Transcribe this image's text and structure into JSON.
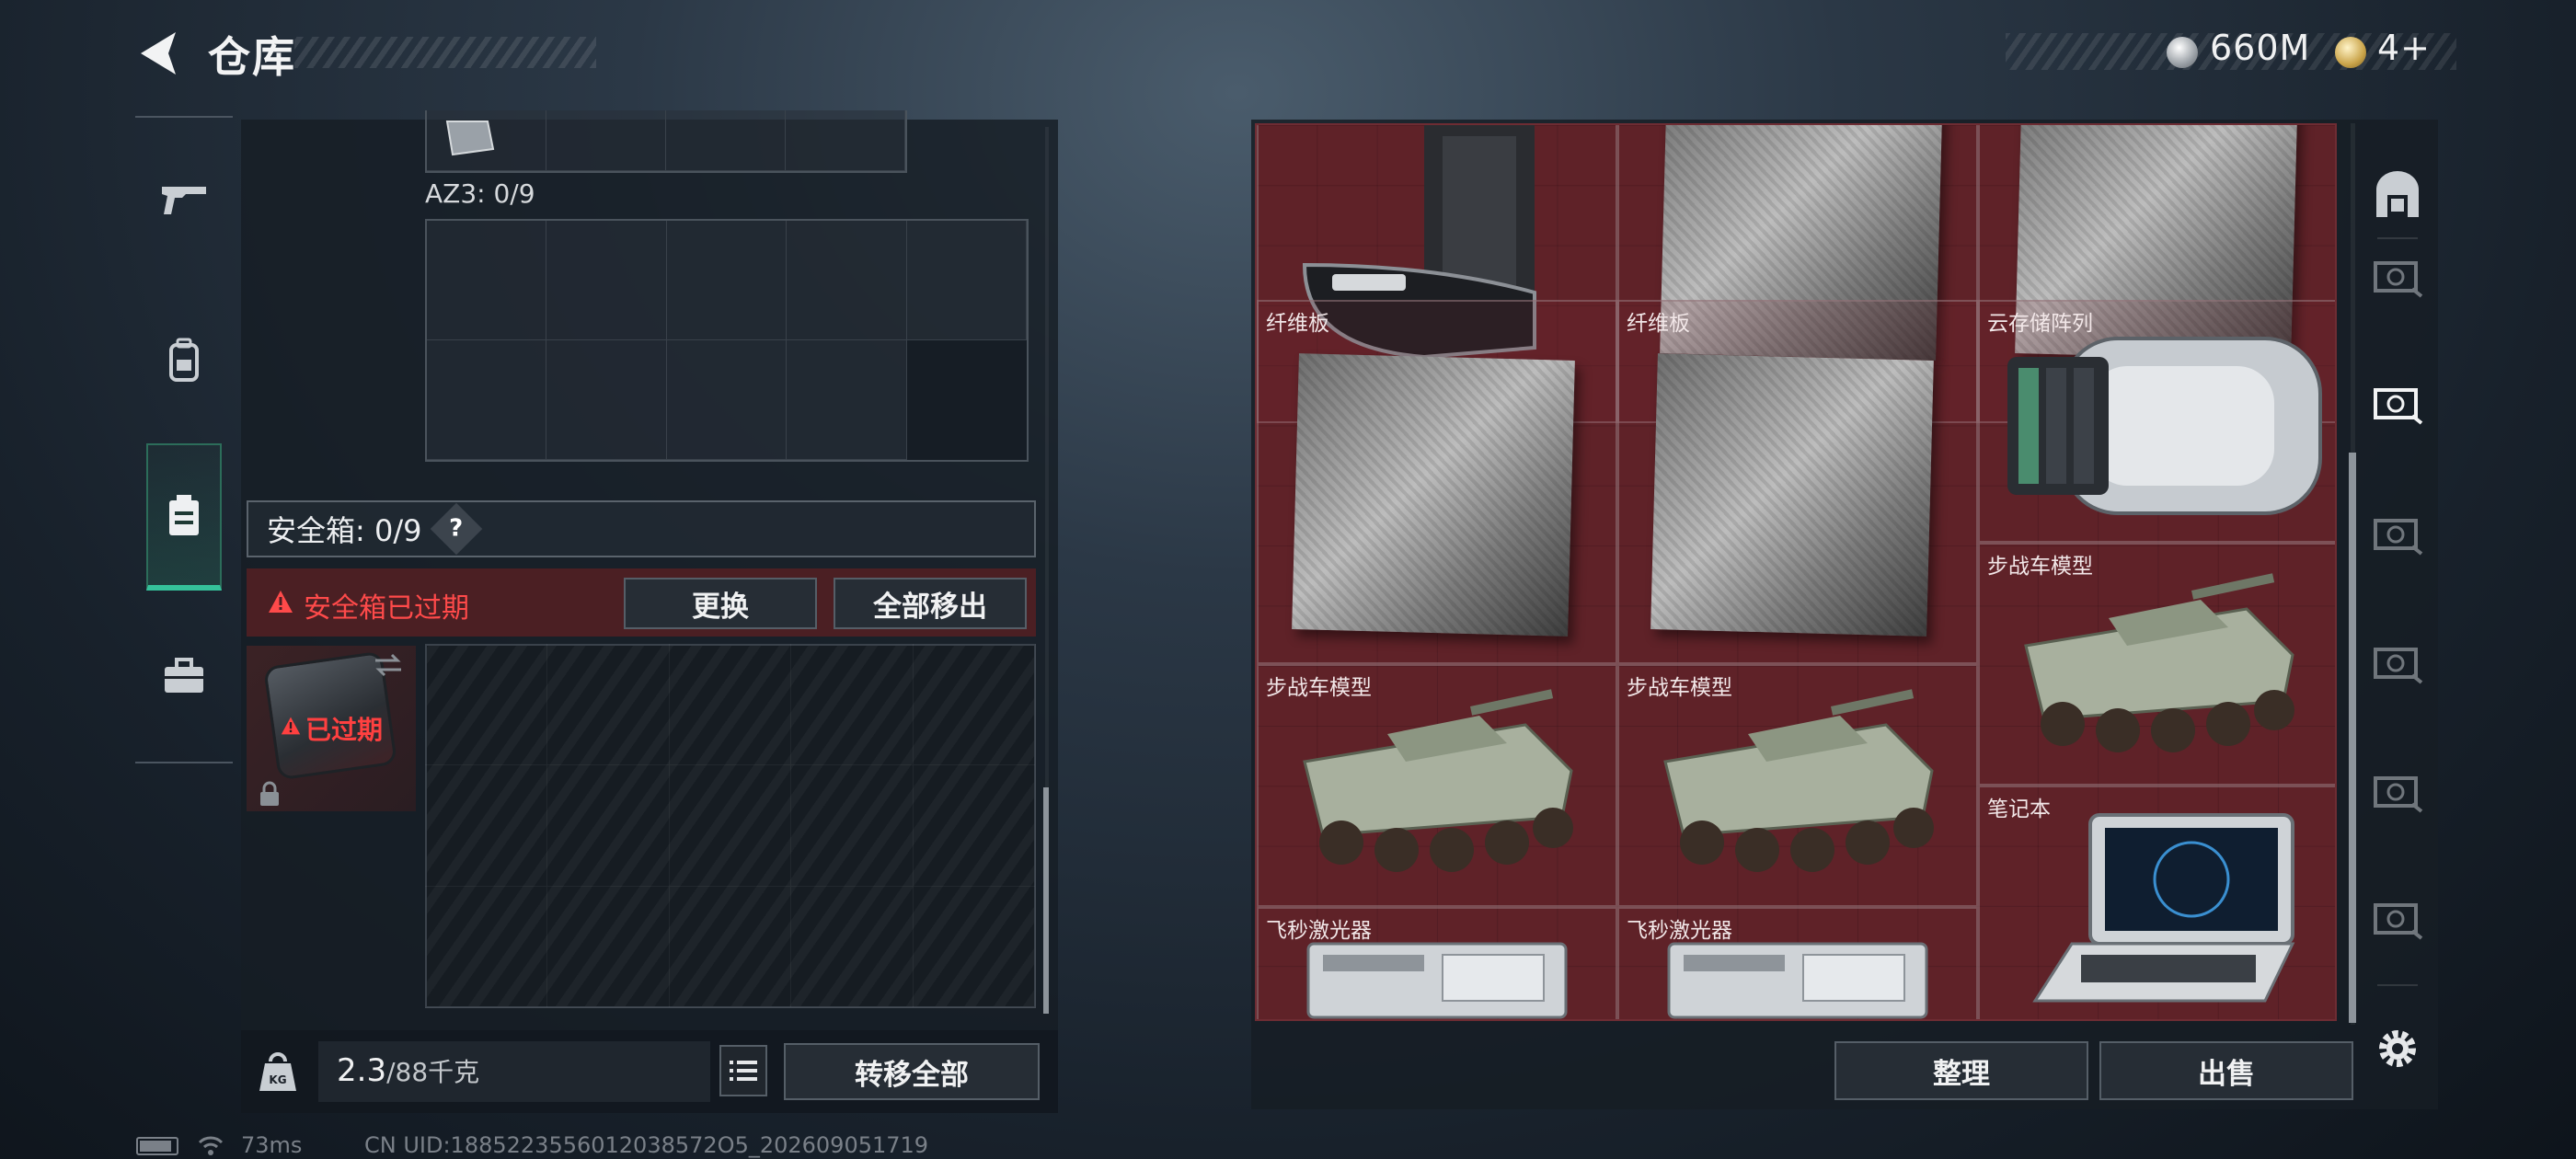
{
  "header": {
    "title": "仓库"
  },
  "currency": [
    {
      "icon": "silver-coin-icon",
      "value": "660M"
    },
    {
      "icon": "gold-coin-icon",
      "value": "4+"
    }
  ],
  "left_nav": [
    {
      "icon": "gun-icon"
    },
    {
      "icon": "backpack-icon"
    },
    {
      "icon": "safe-case-icon",
      "active": true
    },
    {
      "icon": "briefcase-icon"
    }
  ],
  "container": {
    "az3_label": "AZ3: 0/9",
    "safe_label": "安全箱: 0/9",
    "help_mark": "?",
    "expired_warning": "安全箱已过期",
    "replace_button": "更换",
    "move_all_button": "全部移出",
    "thumb_expired": "已过期"
  },
  "footer": {
    "weight_current": "2.3",
    "weight_max": "/88千克",
    "transfer_all": "转移全部"
  },
  "inventory": {
    "items": [
      {
        "name": "",
        "kind": "robot"
      },
      {
        "name": "",
        "kind": "carbon"
      },
      {
        "name": "",
        "kind": "carbon"
      },
      {
        "name": "纤维板",
        "kind": "carbon"
      },
      {
        "name": "纤维板",
        "kind": "carbon"
      },
      {
        "name": "云存储阵列",
        "kind": "server"
      },
      {
        "name": "步战车模型",
        "kind": "tank"
      },
      {
        "name": "步战车模型",
        "kind": "tank"
      },
      {
        "name": "步战车模型",
        "kind": "tank"
      },
      {
        "name": "笔记本",
        "kind": "laptop"
      },
      {
        "name": "飞秒激光器",
        "kind": "laser"
      },
      {
        "name": "飞秒激光器",
        "kind": "laser"
      }
    ],
    "sort_button": "整理",
    "sell_button": "出售"
  },
  "status": {
    "ping": "73ms",
    "uid": "CN UID:1885223556012038572O5_202609051719"
  },
  "colors": {
    "accent": "#35c19a",
    "warning": "#ff4a4a",
    "grid_bg": "#5a2127"
  }
}
